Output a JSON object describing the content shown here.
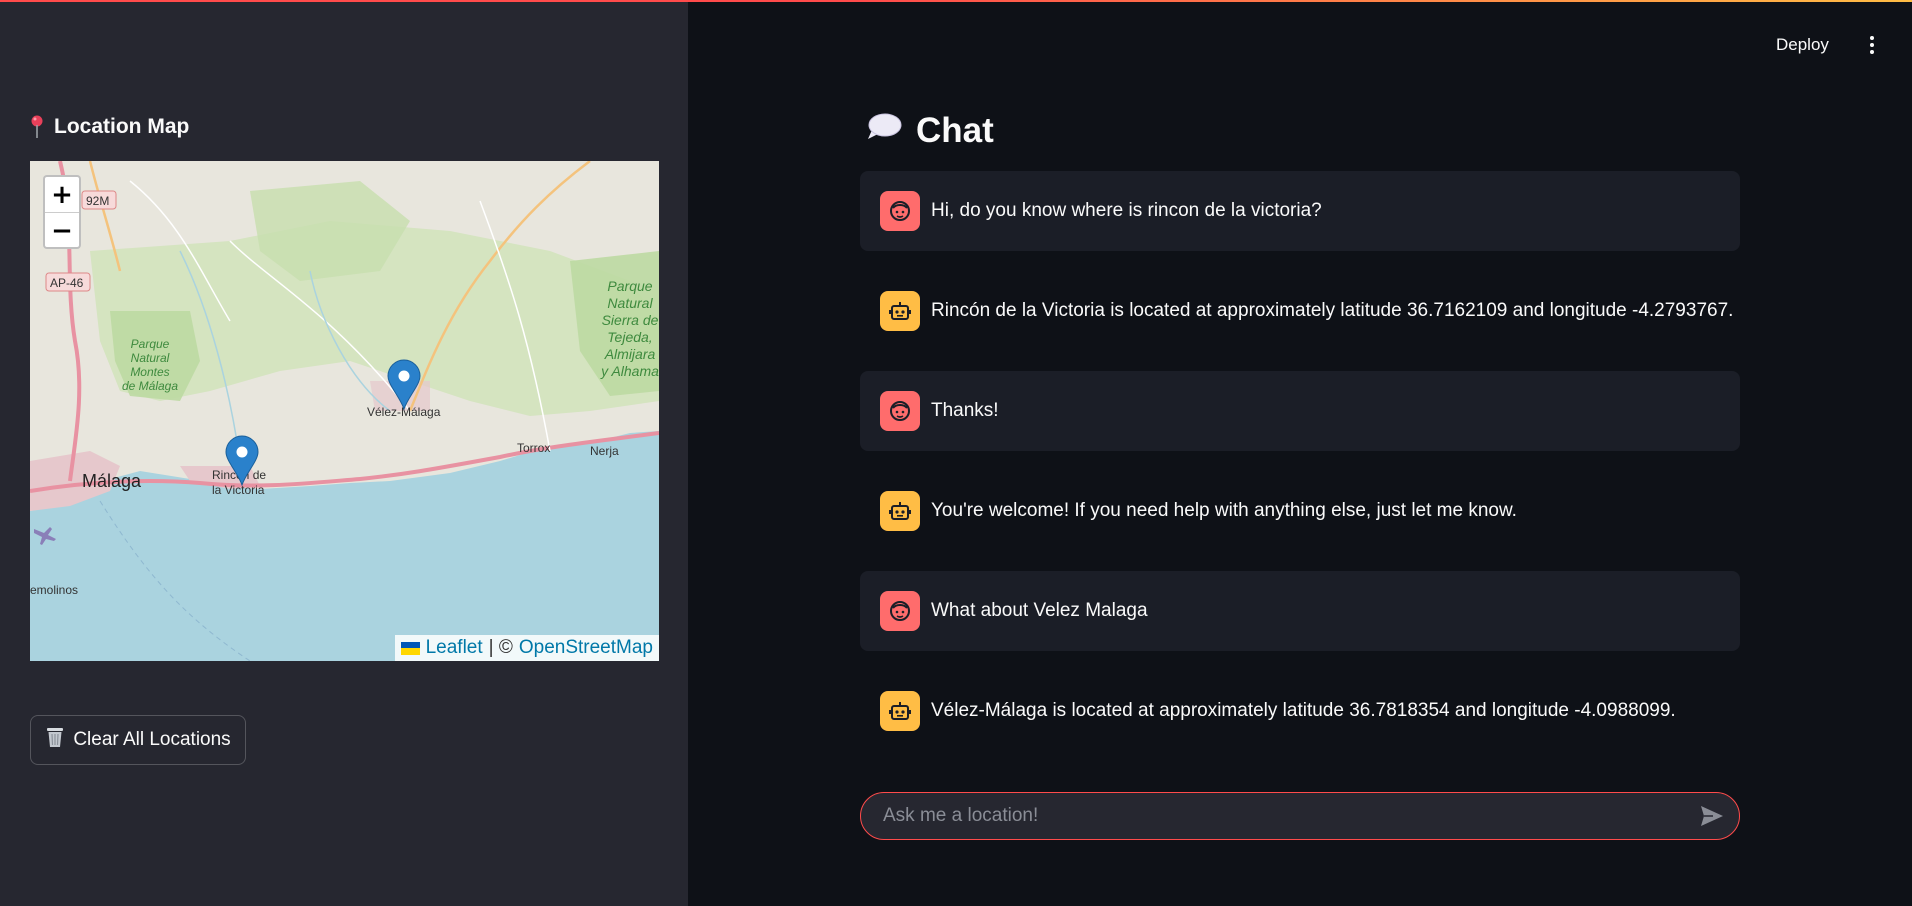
{
  "header": {
    "deploy_label": "Deploy",
    "menu_icon": "kebab-menu-icon"
  },
  "sidebar": {
    "title": "Location Map",
    "title_icon": "map-pin-icon",
    "map": {
      "attribution_leaflet": "Leaflet",
      "attribution_sep": "| ©",
      "attribution_osm": "OpenStreetMap",
      "markers": [
        {
          "label": "Vélez-Málaga",
          "lat": 36.7818354,
          "lon": -4.0988099
        },
        {
          "label": "Rincón de la Victoria",
          "lat": 36.7162109,
          "lon": -4.2793767
        }
      ],
      "place_labels": {
        "malaga": "Málaga",
        "rincon_1": "Rincón de",
        "rincon_2": "la Victoria",
        "velez": "Vélez-Málaga",
        "torrox": "Torrox",
        "nerja": "Nerja",
        "molinos": "emolinos",
        "park_w_1": "Parque",
        "park_w_2": "Natural",
        "park_w_3": "Montes",
        "park_w_4": "de Málaga",
        "park_e_1": "Parque",
        "park_e_2": "Natural",
        "park_e_3": "Sierra de",
        "park_e_4": "Tejeda,",
        "park_e_5": "Almijara",
        "park_e_6": "y Alhama",
        "road_1": "AP-46",
        "road_2": "92M"
      },
      "zoom_in": "+",
      "zoom_out": "−"
    },
    "clear_button": "Clear All Locations"
  },
  "chat": {
    "title": "Chat",
    "messages": [
      {
        "role": "user",
        "text": "Hi, do you know where is rincon de la victoria?"
      },
      {
        "role": "assistant",
        "text": "Rincón de la Victoria is located at approximately latitude 36.7162109 and longitude -4.2793767."
      },
      {
        "role": "user",
        "text": "Thanks!"
      },
      {
        "role": "assistant",
        "text": "You're welcome! If you need help with anything else, just let me know."
      },
      {
        "role": "user",
        "text": "What about Velez Malaga"
      },
      {
        "role": "assistant",
        "text": "Vélez-Málaga is located at approximately latitude 36.7818354 and longitude -4.0988099."
      }
    ],
    "input_placeholder": "Ask me a location!",
    "input_value": ""
  },
  "colors": {
    "accent": "#ff4b4b",
    "user_avatar": "#ff6c6c",
    "bot_avatar": "#ffbd45",
    "marker": "#2a81cb"
  }
}
